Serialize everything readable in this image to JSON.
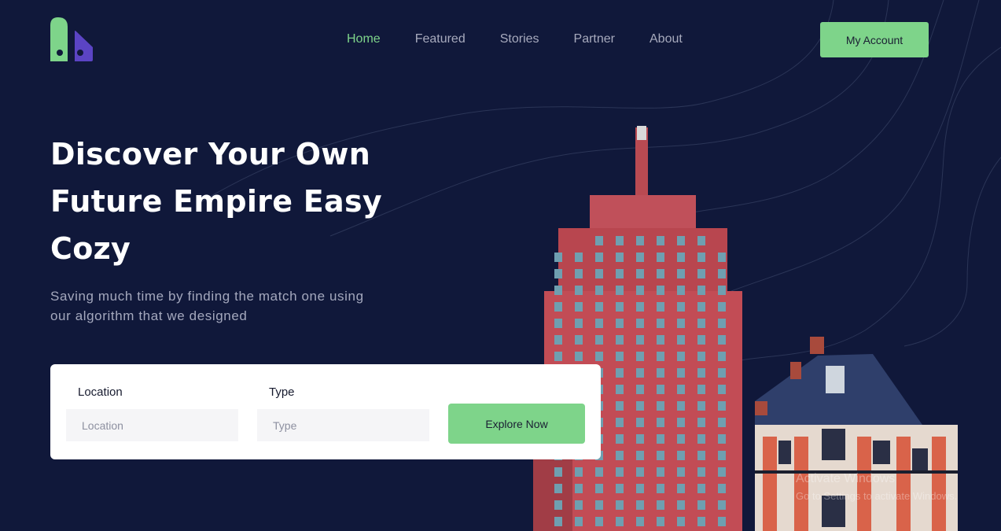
{
  "header": {
    "logo": "logo-icon",
    "nav": [
      {
        "label": "Home",
        "active": true
      },
      {
        "label": "Featured",
        "active": false
      },
      {
        "label": "Stories",
        "active": false
      },
      {
        "label": "Partner",
        "active": false
      },
      {
        "label": "About",
        "active": false
      }
    ],
    "account_label": "My Account"
  },
  "hero": {
    "title_lines": [
      "Discover Your Own",
      "Future Empire Easy",
      "Cozy"
    ],
    "subtitle_lines": [
      "Saving much time by finding the match one using",
      "our algorithm that we designed"
    ]
  },
  "search": {
    "location_label": "Location",
    "location_placeholder": "Location",
    "type_label": "Type",
    "type_placeholder": "Type",
    "explore_label": "Explore Now"
  },
  "watermark": {
    "line1": "Activate Windows",
    "line2": "Go to Settings to activate Windows."
  },
  "colors": {
    "background": "#10183a",
    "accent": "#7ed48a",
    "logo_purple": "#5b44c4",
    "white": "#ffffff"
  }
}
